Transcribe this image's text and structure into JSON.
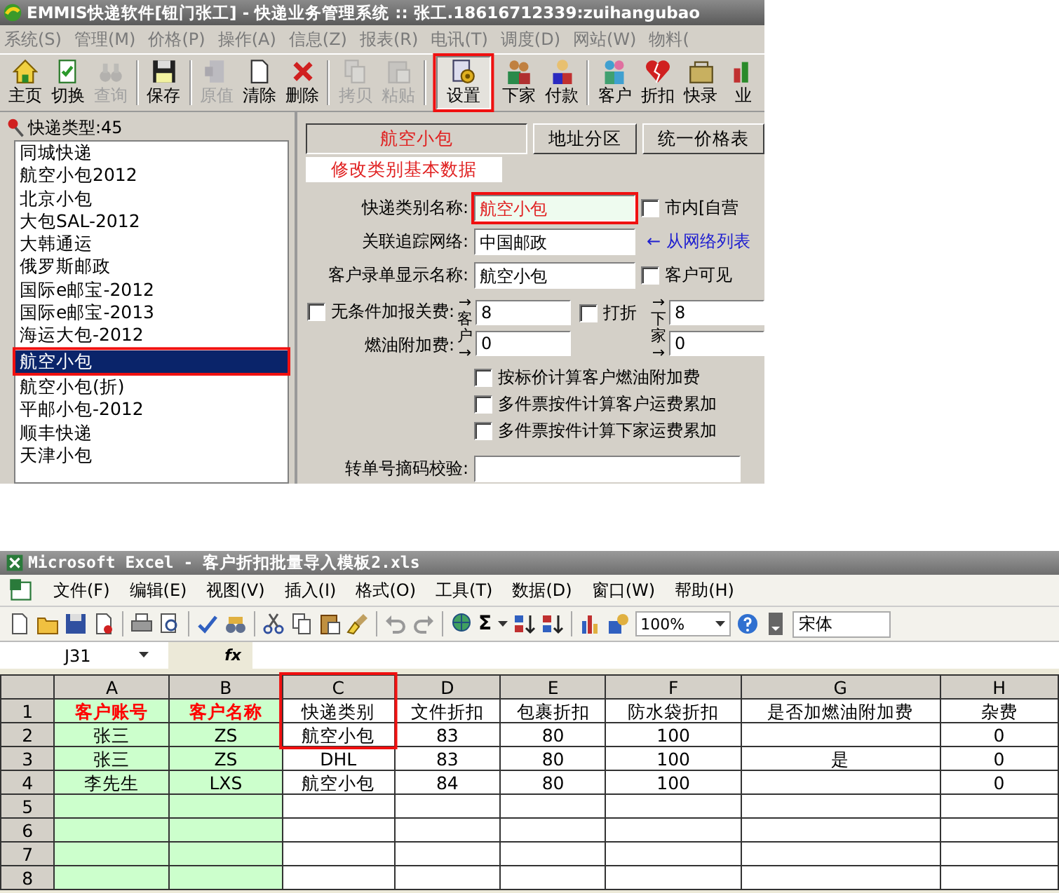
{
  "app": {
    "title": "EMMIS快递软件[钮门张工] - 快递业务管理系统 :: 张工.18616712339:zuihangubao",
    "menu": [
      "系统(S)",
      "管理(M)",
      "价格(P)",
      "操作(A)",
      "信息(Z)",
      "报表(R)",
      "电讯(T)",
      "调度(D)",
      "网站(W)",
      "物料("
    ],
    "toolbar": [
      {
        "label": "主页",
        "disabled": false,
        "selected": false
      },
      {
        "label": "切换",
        "disabled": false,
        "selected": false
      },
      {
        "label": "查询",
        "disabled": true,
        "selected": false
      },
      {
        "label": "保存",
        "disabled": false,
        "selected": false
      },
      {
        "label": "原值",
        "disabled": true,
        "selected": false
      },
      {
        "label": "清除",
        "disabled": false,
        "selected": false
      },
      {
        "label": "删除",
        "disabled": false,
        "selected": false
      },
      {
        "label": "拷贝",
        "disabled": true,
        "selected": false
      },
      {
        "label": "粘贴",
        "disabled": true,
        "selected": false
      },
      {
        "label": "设置",
        "disabled": false,
        "selected": true
      },
      {
        "label": "下家",
        "disabled": false,
        "selected": false
      },
      {
        "label": "付款",
        "disabled": false,
        "selected": false
      },
      {
        "label": "客户",
        "disabled": false,
        "selected": false
      },
      {
        "label": "折扣",
        "disabled": false,
        "selected": false
      },
      {
        "label": "快录",
        "disabled": false,
        "selected": false
      },
      {
        "label": "业",
        "disabled": false,
        "selected": false
      }
    ],
    "type_list": {
      "header": "快递类型:45",
      "items": [
        {
          "label": "同城快递",
          "selected": false
        },
        {
          "label": "航空小包2012",
          "selected": false
        },
        {
          "label": "北京小包",
          "selected": false
        },
        {
          "label": "大包SAL-2012",
          "selected": false
        },
        {
          "label": "大韩通运",
          "selected": false
        },
        {
          "label": "俄罗斯邮政",
          "selected": false
        },
        {
          "label": "国际e邮宝-2012",
          "selected": false
        },
        {
          "label": "国际e邮宝-2013",
          "selected": false
        },
        {
          "label": "海运大包-2012",
          "selected": false
        },
        {
          "label": "航空小包",
          "selected": true
        },
        {
          "label": "航空小包(折)",
          "selected": false
        },
        {
          "label": "平邮小包-2012",
          "selected": false
        },
        {
          "label": "顺丰快递",
          "selected": false
        },
        {
          "label": "天津小包",
          "selected": false
        }
      ]
    },
    "tabs": [
      {
        "label": "航空小包",
        "selected": true
      },
      {
        "label": "地址分区",
        "selected": false
      },
      {
        "label": "统一价格表",
        "selected": false
      }
    ],
    "subtab": "修改类别基本数据",
    "form": {
      "name": {
        "label": "快递类别名称:",
        "value": "航空小包"
      },
      "city_check": {
        "label": "市内[自营",
        "checked": false
      },
      "tracking": {
        "label": "关联追踪网络:",
        "value": "中国邮政"
      },
      "network_link": "← 从网络列表",
      "display_name": {
        "label": "客户录单显示名称:",
        "value": "航空小包"
      },
      "visible_check": {
        "label": "客户可见",
        "checked": false
      },
      "customs_check": {
        "label": "无条件加报关费:",
        "checked": false
      },
      "fuel_label": "燃油附加费:",
      "customer_side": {
        "label": "→客户→",
        "customs": "8",
        "fuel": "0"
      },
      "discount_check": {
        "label": "打折",
        "checked": false
      },
      "agent_side": {
        "label": "→下家→",
        "customs": "8",
        "fuel": "0"
      },
      "options": [
        {
          "label": "按标价计算客户燃油附加费",
          "checked": false
        },
        {
          "label": "多件票按件计算客户运费累加",
          "checked": false
        },
        {
          "label": "多件票按件计算下家运费累加",
          "checked": false
        }
      ],
      "transfer": {
        "label": "转单号摘码校验:"
      }
    }
  },
  "excel": {
    "title": "Microsoft Excel - 客户折扣批量导入模板2.xls",
    "menu": [
      "文件(F)",
      "编辑(E)",
      "视图(V)",
      "插入(I)",
      "格式(O)",
      "工具(T)",
      "数据(D)",
      "窗口(W)",
      "帮助(H)"
    ],
    "toolbar": {
      "sum": "Σ",
      "zoom": "100%",
      "font": "宋体"
    },
    "name_box": "J31",
    "fx": "fx",
    "columns": [
      {
        "letter": "A",
        "key": true
      },
      {
        "letter": "B",
        "key": true
      },
      {
        "letter": "C",
        "key": false
      },
      {
        "letter": "D",
        "key": false
      },
      {
        "letter": "E",
        "key": false
      },
      {
        "letter": "F",
        "key": false
      },
      {
        "letter": "G",
        "key": false
      },
      {
        "letter": "H",
        "key": false
      }
    ],
    "rows": [
      {
        "number": "1",
        "cells": [
          "客户账号",
          "客户名称",
          "快递类别",
          "文件折扣",
          "包裹折扣",
          "防水袋折扣",
          "是否加燃油附加费",
          "杂费"
        ]
      },
      {
        "number": "2",
        "cells": [
          "张三",
          "ZS",
          "航空小包",
          "83",
          "80",
          "100",
          null,
          "0"
        ]
      },
      {
        "number": "3",
        "cells": [
          "张三",
          "ZS",
          "DHL",
          "83",
          "80",
          "100",
          "是",
          "0"
        ]
      },
      {
        "number": "4",
        "cells": [
          "李先生",
          "LXS",
          "航空小包",
          "84",
          "80",
          "100",
          null,
          "0"
        ]
      },
      {
        "number": "5"
      },
      {
        "number": "6"
      },
      {
        "number": "7"
      },
      {
        "number": "8"
      }
    ]
  }
}
